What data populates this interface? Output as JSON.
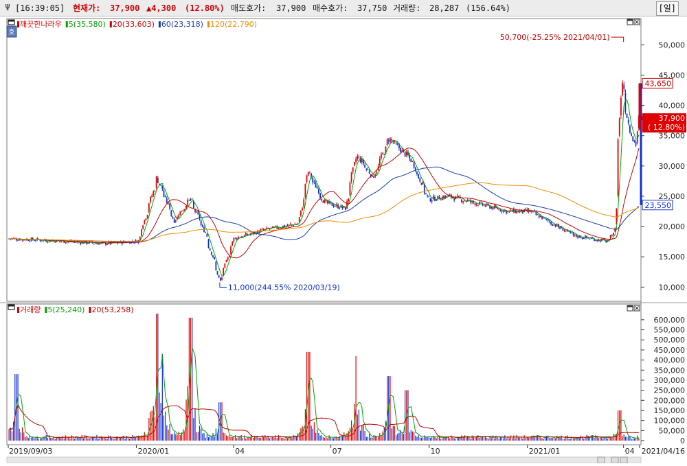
{
  "topbar": {
    "logo_icon": "tuning-fork-icon",
    "time": "[16:39:05]",
    "price_label": "현재가:",
    "price_value": "37,900",
    "change": "▲4,300",
    "change_pct": "(12.80%)",
    "ask_label": "매도호가:",
    "ask_value": "37,900",
    "bid_label": "매수호가:",
    "bid_value": "37,750",
    "volume_label": "거래량:",
    "volume_value": "28,287",
    "volume_pct": "(156.64%)",
    "period_button": "[일]"
  },
  "price_panel": {
    "legend_icon": "window-icon",
    "legend": [
      {
        "text": "깨끗한나라우",
        "color": "#d00000"
      },
      {
        "text": "5(35,580)",
        "color": "#00a000"
      },
      {
        "text": "20(33,603)",
        "color": "#c00000"
      },
      {
        "text": "60(23,318)",
        "color": "#1a3aa8"
      },
      {
        "text": "120(22,790)",
        "color": "#f08c00"
      }
    ],
    "side_label": "호",
    "high_annotation": "50,700(-25.25% 2021/04/01)",
    "low_annotation": "11,000(244.55% 2020/03/19)",
    "tag_high": "43,650",
    "tag_current_price": "37,900",
    "tag_current_pct": "( 12.80%)",
    "tag_low": "23,550",
    "y_ticks": [
      "50,000",
      "45,000",
      "40,000",
      "35,000",
      "30,000",
      "25,000",
      "20,000",
      "15,000",
      "10,000"
    ]
  },
  "volume_panel": {
    "legend": [
      {
        "text": "거래량",
        "color": "#d00000"
      },
      {
        "text": "5(25,240)",
        "color": "#00a000"
      },
      {
        "text": "20(53,258)",
        "color": "#c00000"
      }
    ],
    "y_ticks": [
      "600,000",
      "550,000",
      "500,000",
      "450,000",
      "400,000",
      "350,000",
      "300,000",
      "250,000",
      "200,000",
      "150,000",
      "100,000",
      "50,000",
      "0"
    ]
  },
  "x_axis": {
    "labels": [
      "2019/09/03",
      "2020/01",
      "04",
      "07",
      "10",
      "2021/01",
      "04",
      "2021/04/16"
    ]
  },
  "colors": {
    "up": "#e00000",
    "down": "#1030d0",
    "ma5": "#00a000",
    "ma20": "#c00000",
    "ma60": "#1a3aa8",
    "ma120": "#f08c00"
  },
  "chart_data": [
    {
      "type": "candlestick",
      "title": "깨끗한나라우",
      "ylim": [
        8000,
        54000
      ],
      "x_range": [
        "2019/09/03",
        "2021/04/16"
      ],
      "close_trend": [
        {
          "date": "2019/09/03",
          "close": 18000
        },
        {
          "date": "2019/10/01",
          "close": 17800
        },
        {
          "date": "2019/12/01",
          "close": 17200
        },
        {
          "date": "2020/01/02",
          "close": 17600
        },
        {
          "date": "2020/01/20",
          "close": 28000
        },
        {
          "date": "2020/02/05",
          "close": 21000
        },
        {
          "date": "2020/02/20",
          "close": 24500
        },
        {
          "date": "2020/03/05",
          "close": 19000
        },
        {
          "date": "2020/03/19",
          "close": 11000
        },
        {
          "date": "2020/04/01",
          "close": 18000
        },
        {
          "date": "2020/05/01",
          "close": 19500
        },
        {
          "date": "2020/06/01",
          "close": 20500
        },
        {
          "date": "2020/06/10",
          "close": 29000
        },
        {
          "date": "2020/06/25",
          "close": 24000
        },
        {
          "date": "2020/07/15",
          "close": 23000
        },
        {
          "date": "2020/07/25",
          "close": 32000
        },
        {
          "date": "2020/08/10",
          "close": 28000
        },
        {
          "date": "2020/08/25",
          "close": 34500
        },
        {
          "date": "2020/09/15",
          "close": 31000
        },
        {
          "date": "2020/10/01",
          "close": 24500
        },
        {
          "date": "2020/10/20",
          "close": 25000
        },
        {
          "date": "2020/12/15",
          "close": 22500
        },
        {
          "date": "2021/01/05",
          "close": 22500
        },
        {
          "date": "2021/02/15",
          "close": 18500
        },
        {
          "date": "2021/03/20",
          "close": 17500
        },
        {
          "date": "2021/03/25",
          "close": 19500
        },
        {
          "date": "2021/03/30",
          "close": 38000
        },
        {
          "date": "2021/04/01",
          "close": 44000
        },
        {
          "date": "2021/04/08",
          "close": 36000
        },
        {
          "date": "2021/04/14",
          "close": 33600
        },
        {
          "date": "2021/04/16",
          "close": 37900
        }
      ],
      "series": [
        {
          "name": "5",
          "last": 35580
        },
        {
          "name": "20",
          "last": 33603
        },
        {
          "name": "60",
          "last": 23318
        },
        {
          "name": "120",
          "last": 22790
        }
      ],
      "annotations": [
        {
          "text": "50,700(-25.25% 2021/04/01)",
          "value": 50700
        },
        {
          "text": "11,000(244.55% 2020/03/19)",
          "value": 11000
        }
      ]
    },
    {
      "type": "bar",
      "title": "거래량",
      "ylim": [
        0,
        620000
      ],
      "spikes": [
        {
          "date": "2019/09/10",
          "value": 330000
        },
        {
          "date": "2020/01/20",
          "value": 630000
        },
        {
          "date": "2020/01/25",
          "value": 430000
        },
        {
          "date": "2020/02/20",
          "value": 610000
        },
        {
          "date": "2020/03/19",
          "value": 190000
        },
        {
          "date": "2020/06/10",
          "value": 440000
        },
        {
          "date": "2020/07/25",
          "value": 420000
        },
        {
          "date": "2020/08/25",
          "value": 320000
        },
        {
          "date": "2020/09/10",
          "value": 250000
        },
        {
          "date": "2021/03/30",
          "value": 150000
        }
      ],
      "series": [
        {
          "name": "5",
          "last": 25240
        },
        {
          "name": "20",
          "last": 53258
        }
      ]
    }
  ]
}
